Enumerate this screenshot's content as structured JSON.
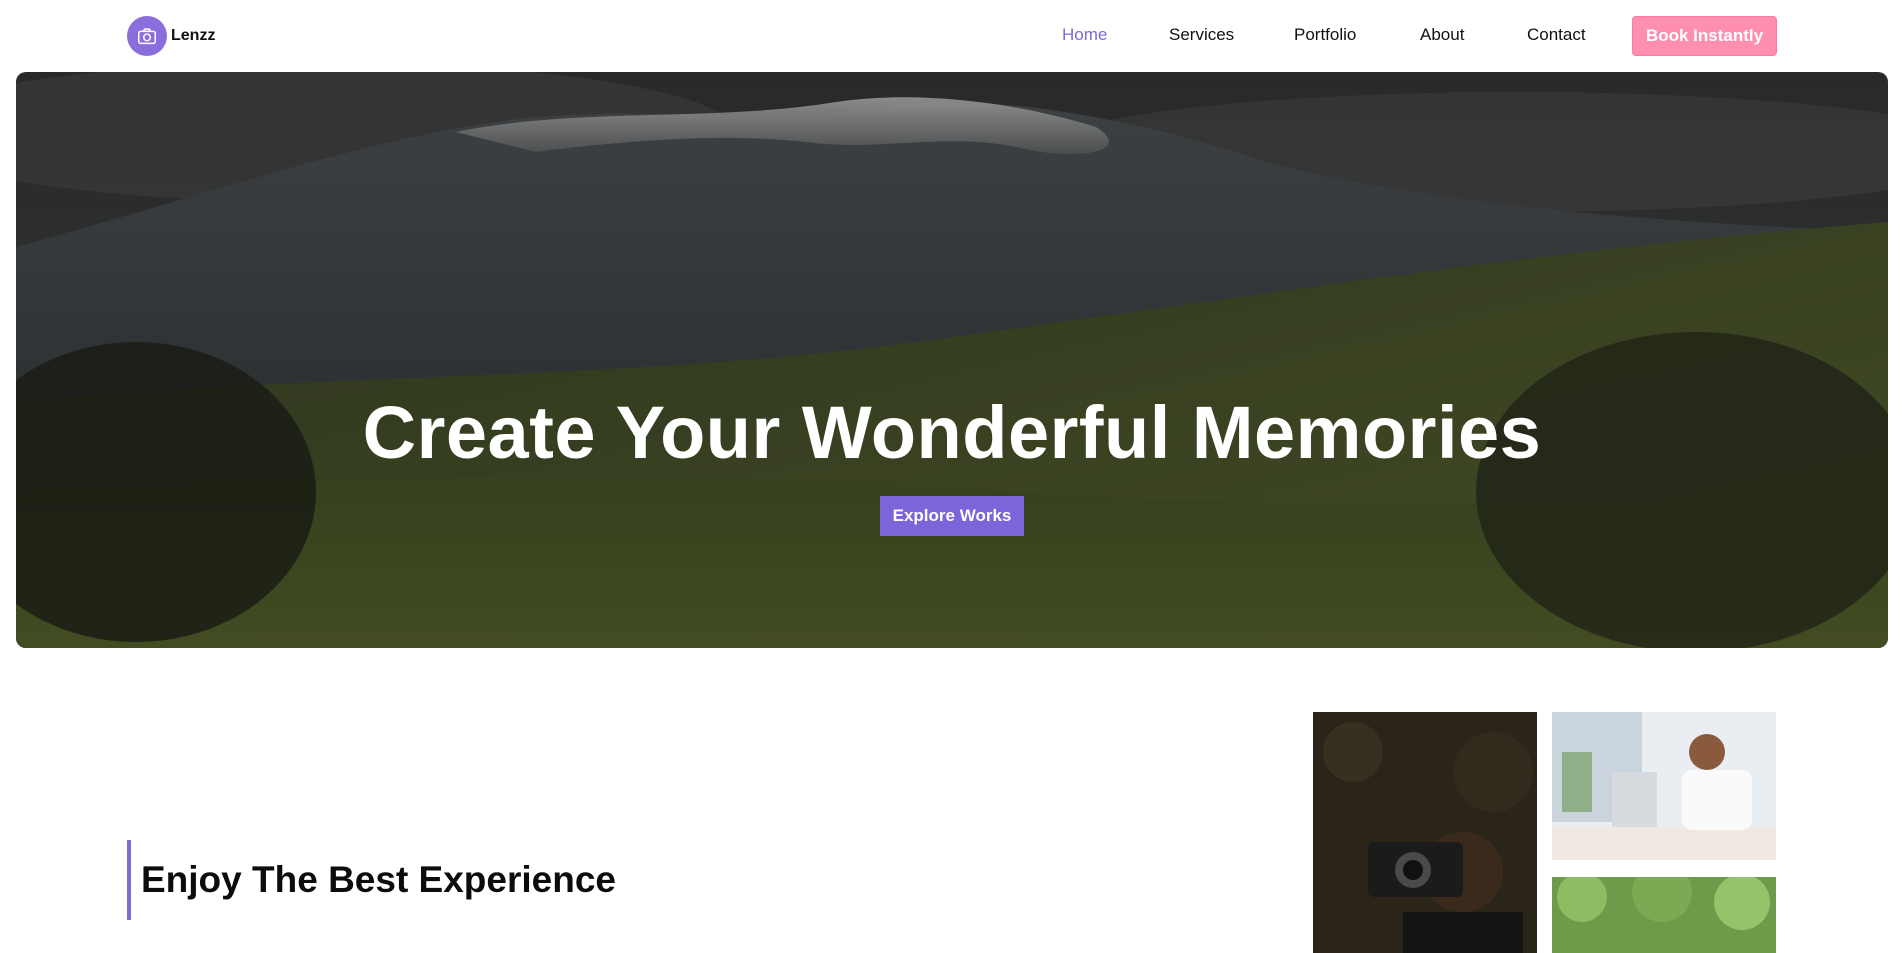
{
  "brand": {
    "name": "Lenzz",
    "logo_icon": "camera-icon"
  },
  "nav": {
    "items": [
      {
        "label": "Home",
        "active": true
      },
      {
        "label": "Services",
        "active": false
      },
      {
        "label": "Portfolio",
        "active": false
      },
      {
        "label": "About",
        "active": false
      },
      {
        "label": "Contact",
        "active": false
      }
    ],
    "cta_label": "Book Instantly"
  },
  "hero": {
    "title": "Create Your Wonderful Memories",
    "button_label": "Explore Works"
  },
  "experience": {
    "heading": "Enjoy The Best Experience"
  },
  "colors": {
    "accent": "#7e6bd8",
    "cta": "#ff8fb0",
    "text": "#111111"
  }
}
